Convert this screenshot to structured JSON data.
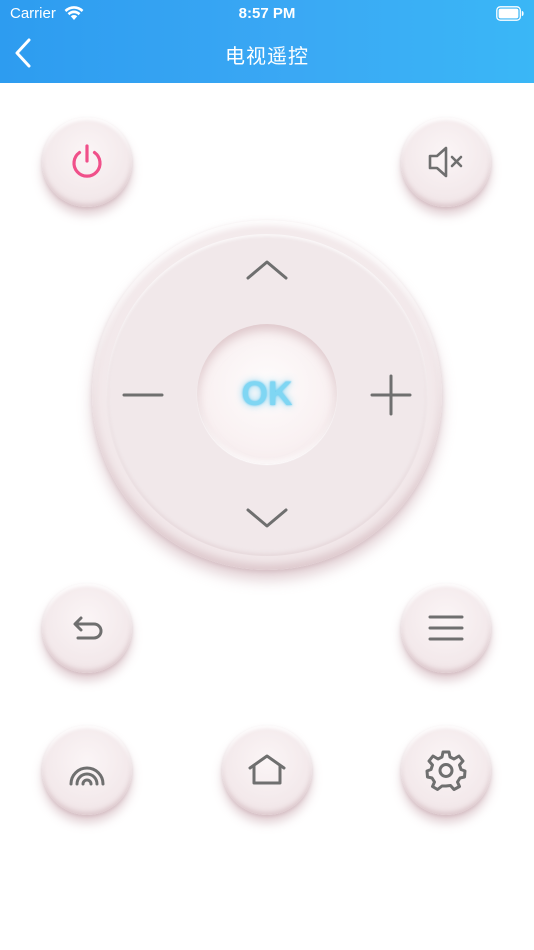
{
  "status_bar": {
    "carrier": "Carrier",
    "time": "8:57 PM"
  },
  "nav": {
    "title": "电视遥控",
    "back_icon": "chevron-left-icon"
  },
  "remote": {
    "ok_label": "OK",
    "buttons": {
      "power": "power-icon",
      "mute": "volume-mute-icon",
      "back": "return-arrow-icon",
      "menu": "menu-icon",
      "signal": "signal-source-icon",
      "home": "home-icon",
      "settings": "gear-icon"
    }
  },
  "colors": {
    "header_gradient_start": "#2d9cf0",
    "header_gradient_end": "#3ab7f6",
    "power_accent": "#f0508a",
    "icon_gray": "#6f6f6f",
    "ok_glow": "#7fd6f3",
    "button_surface": "#f3e9eb"
  }
}
